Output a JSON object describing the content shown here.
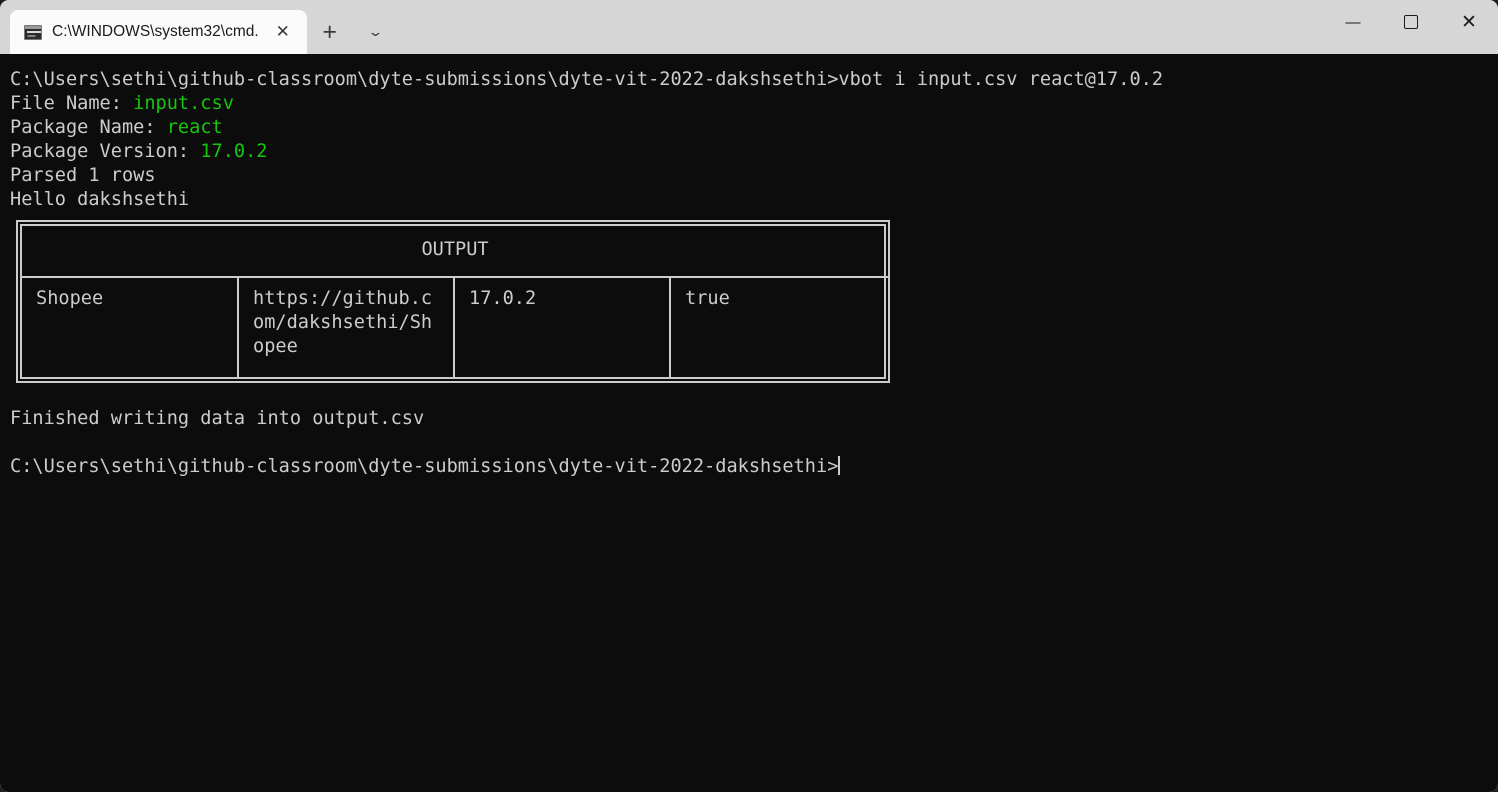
{
  "window": {
    "tab": {
      "title": "C:\\WINDOWS\\system32\\cmd.",
      "icon": "console-icon",
      "close_label": "✕"
    },
    "new_tab_label": "+",
    "dropdown_label": "⌄",
    "caption": {
      "minimize_label": "—",
      "maximize_label": "",
      "close_label": "✕"
    }
  },
  "terminal": {
    "background_color": "#0c0c0c",
    "foreground_color": "#cccccc",
    "accent_green": "#16c60c",
    "prompt_line": {
      "path": "C:\\Users\\sethi\\github-classroom\\dyte-submissions\\dyte-vit-2022-dakshsethi>",
      "command": "vbot i input.csv react@17.0.2"
    },
    "output_lines": [
      {
        "label": "File Name: ",
        "value": "input.csv"
      },
      {
        "label": "Package Name: ",
        "value": "react"
      },
      {
        "label": "Package Version: ",
        "value": "17.0.2"
      }
    ],
    "parsed_line": "Parsed 1 rows",
    "hello_line": "Hello dakshsethi",
    "finished_line": "Finished writing data into output.csv",
    "final_prompt": "C:\\Users\\sethi\\github-classroom\\dyte-submissions\\dyte-vit-2022-dakshsethi>"
  },
  "output_table": {
    "header": "OUTPUT",
    "row": {
      "name": "Shopee",
      "url": "https://github.com/dakshsethi/Shopee",
      "version": "17.0.2",
      "status": "true"
    }
  }
}
